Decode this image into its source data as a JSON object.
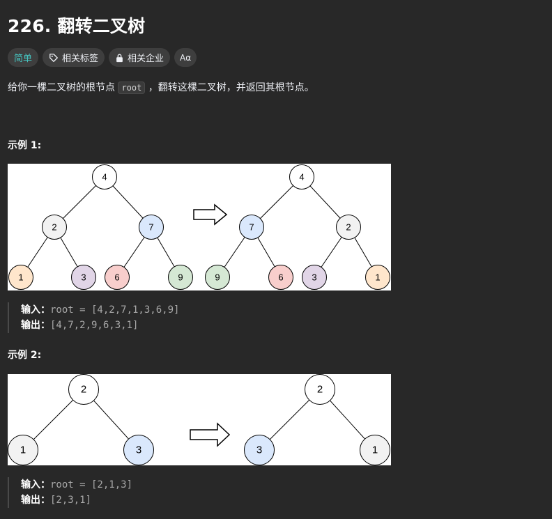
{
  "problem": {
    "title": "226. 翻转二叉树",
    "tags": {
      "difficulty": "简单",
      "related_topics": "相关标签",
      "related_companies": "相关企业",
      "font_toggle": "Aα"
    },
    "description": {
      "before": "给你一棵二叉树的根节点 ",
      "code": "root",
      "after": " ，翻转这棵二叉树，并返回其根节点。"
    }
  },
  "example1": {
    "title": "示例 1:",
    "input_label": "输入：",
    "input_value": "root = [4,2,7,1,3,6,9]",
    "output_label": "输出：",
    "output_value": "[4,7,2,9,6,3,1]",
    "tree_before": [
      "4",
      "2",
      "7",
      "1",
      "3",
      "6",
      "9"
    ],
    "tree_after": [
      "4",
      "7",
      "2",
      "9",
      "6",
      "3",
      "1"
    ]
  },
  "example2": {
    "title": "示例 2:",
    "input_label": "输入：",
    "input_value": "root = [2,1,3]",
    "output_label": "输出：",
    "output_value": "[2,3,1]",
    "tree_before": [
      "2",
      "1",
      "3"
    ],
    "tree_after": [
      "2",
      "3",
      "1"
    ]
  },
  "colors": {
    "node_4_2": "#f2f2f2",
    "node_7": "#dae8fc",
    "node_1": "#ffe6cc",
    "node_3": "#e1d5e7",
    "node_6": "#f8cecc",
    "node_9": "#d5e8d4",
    "white": "#ffffff",
    "accent_easy": "#46c6c2"
  }
}
